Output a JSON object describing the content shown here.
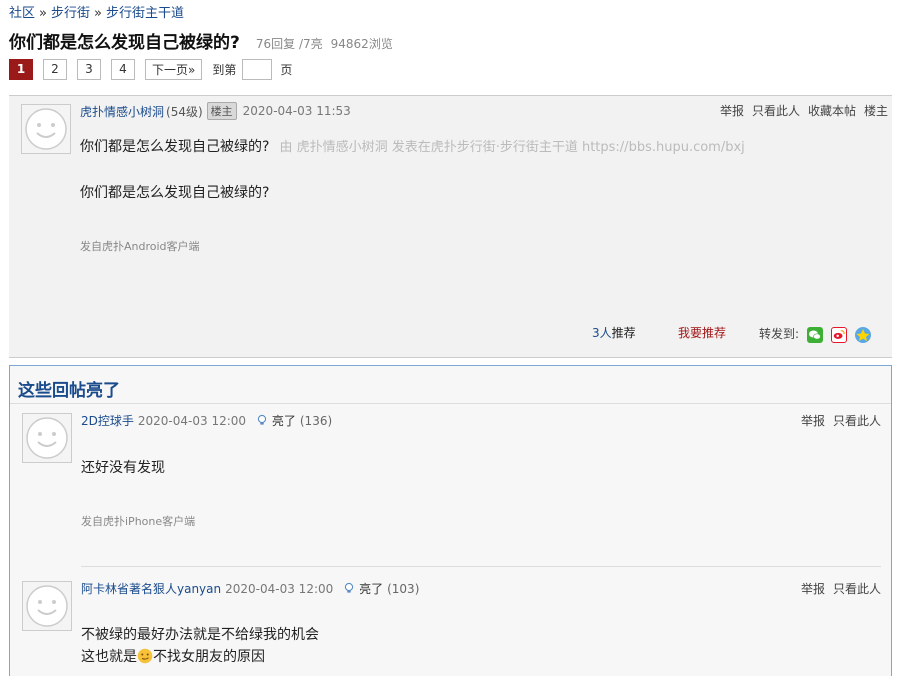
{
  "breadcrumb": {
    "community": "社区",
    "sep": "»",
    "street": "步行街",
    "main": "步行街主干道"
  },
  "thread": {
    "title": "你们都是怎么发现自己被绿的?",
    "replies": "76回复 /7亮",
    "views": "94862浏览"
  },
  "pager": {
    "pages": [
      "1",
      "2",
      "3",
      "4"
    ],
    "next": "下一页»",
    "goto_prefix": "到第",
    "goto_suffix": "页"
  },
  "main_post": {
    "username": "虎扑情感小树洞",
    "level": "(54级)",
    "badge": "楼主",
    "time": "2020-04-03 11:53",
    "actions": [
      "举报",
      "只看此人",
      "收藏本帖",
      "楼主"
    ],
    "line1": "你们都是怎么发现自己被绿的?",
    "from_text": "由  虎扑情感小树洞 发表在虎扑步行街·步行街主干道 https://bbs.hupu.com/bxj",
    "line2": "你们都是怎么发现自己被绿的?",
    "client": "发自虎扑Android客户端",
    "recommend_count": "3人",
    "recommend_label": "推荐",
    "recommend_action": "我要推荐",
    "share_label": "转发到:"
  },
  "lit": {
    "title": "这些回帖亮了",
    "replies": [
      {
        "username": "2D控球手",
        "time": "2020-04-03 12:00",
        "light_label": "亮了",
        "light_count": "(136)",
        "actions": [
          "举报",
          "只看此人"
        ],
        "body": "还好没有发现",
        "client": "发自虎扑iPhone客户端"
      },
      {
        "username": "阿卡林省著名狠人yanyan",
        "time": "2020-04-03 12:00",
        "light_label": "亮了",
        "light_count": "(103)",
        "actions": [
          "举报",
          "只看此人"
        ],
        "body1": "不被绿的最好办法就是不给绿我的机会",
        "body2_pre": "这也就是",
        "body2_post": "不找女朋友的原因"
      }
    ]
  },
  "colors": {
    "link": "#1a4b8c",
    "active_page": "#9a1a1a",
    "recommend": "#a31515",
    "wechat": "#3cb034",
    "weibo": "#e6162d"
  }
}
